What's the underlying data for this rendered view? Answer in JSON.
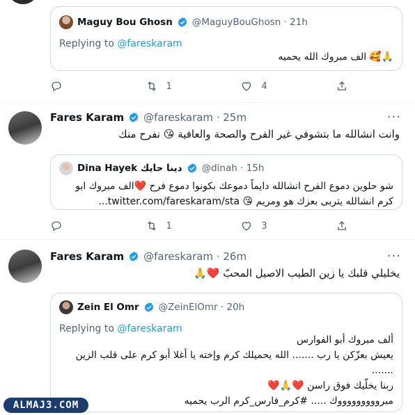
{
  "tweet1": {
    "quote": {
      "name": "Maguy Bou Ghosn",
      "handle": "@MaguyBouGhosn · 21h",
      "replying_prefix": "Replying to ",
      "replying_handle": "@fareskaram",
      "text": "الف مبروك الله يحميه",
      "emoji": "🙏🥰"
    },
    "actions": {
      "reply": "",
      "retweet": "1",
      "like": "4",
      "share": ""
    }
  },
  "tweet2": {
    "name": "Fares Karam",
    "handle": "@fareskaram · 25m",
    "more": "···",
    "text": "وانت انشالله ما بتشوفي غير الفرح والصحة والعافية 😘 نفرح منك",
    "quote": {
      "name_ar": "دينا حايك",
      "name": "Dina Hayek",
      "handle": "@dinah · 15h",
      "line1": "شو حلوين دموع الفرح انشالله دايماً دموعك بكونوا دموع فرح ❤️الف مبروك ابو",
      "line2": "كرم  انشالله يتربى بعزك هو ومريم 😘 twitter.com/fareskaram/sta..."
    },
    "actions": {
      "reply": "",
      "retweet": "1",
      "like": "3",
      "share": ""
    }
  },
  "tweet3": {
    "name": "Fares Karam",
    "handle": "@fareskaram · 26m",
    "more": "···",
    "text": "يخليلي قلبك يا زين الطيب الاصيل المحبّ ❤️🙏",
    "quote": {
      "name": "Zein El Omr",
      "handle": "@ZeinElOmr · 20h",
      "replying_prefix": "Replying to ",
      "replying_handle": "@fareskaram",
      "line1": "ألف مبروك أبو الفوارس",
      "line2": "يعيش بعزّكن يا رب  ....... الله يحميلك كرم وإخته يا أغلا أبو كرم على قلب الزين",
      "line3": ".......",
      "line4": "ربنا يخلّيك فوق راسن ❤️🙏❤️",
      "line5": "مبروووووووووك ..... #كرم_فارس_كرم الرب يحميه"
    }
  },
  "watermark": "ALMAJ3.COM",
  "colors": {
    "accent": "#1d9bf0",
    "verified": "#1d9bf0",
    "muted": "#536471",
    "border": "#cfd9de",
    "like_heart": "#f91880"
  },
  "icons": [
    "reply-icon",
    "retweet-icon",
    "like-icon",
    "share-icon",
    "verified-badge-icon",
    "more-icon"
  ]
}
